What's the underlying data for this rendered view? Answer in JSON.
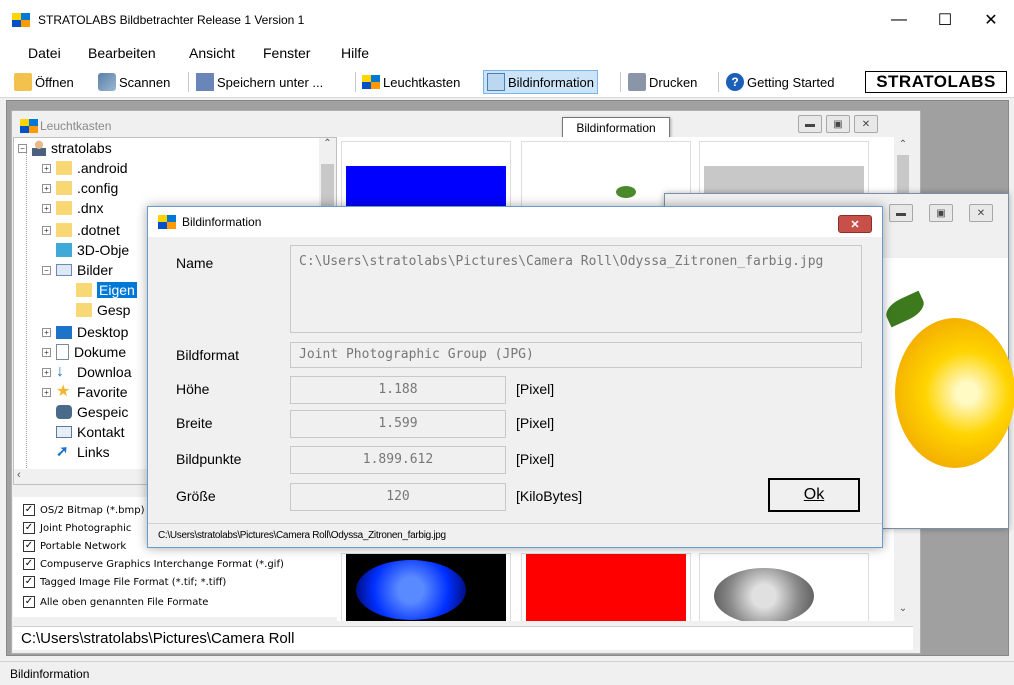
{
  "window": {
    "title": "STRATOLABS Bildbetrachter Release 1 Version 1"
  },
  "menu": [
    "Datei",
    "Bearbeiten",
    "Ansicht",
    "Fenster",
    "Hilfe"
  ],
  "toolbar": {
    "open": "Öffnen",
    "scan": "Scannen",
    "save_as": "Speichern unter ...",
    "lightbox": "Leuchtkasten",
    "image_info": "Bildinformation",
    "print": "Drucken",
    "getting_started": "Getting Started",
    "brand": "STRATOLABS"
  },
  "tooltip": "Bildinformation",
  "lightbox": {
    "title": "Leuchtkasten",
    "tree": {
      "root": "stratolabs",
      "items": [
        ".android",
        ".config",
        ".dnx",
        ".dotnet",
        "3D-Obje",
        "Bilder",
        "Eigen",
        "Gesp",
        "Desktop",
        "Dokume",
        "Downloa",
        "Favorite",
        "Gespeic",
        "Kontakt",
        "Links"
      ]
    },
    "formats": [
      "OS/2 Bitmap (*.bmp)",
      "Joint Photographic",
      "Portable Network",
      "Compuserve Graphics Interchange Format (*.gif)",
      "Tagged Image File Format (*.tif; *.tiff)",
      "Alle oben genannten File Formate"
    ],
    "path": "C:\\Users\\stratolabs\\Pictures\\Camera Roll"
  },
  "dialog": {
    "title": "Bildinformation",
    "name_label": "Name",
    "name_value": "C:\\Users\\stratolabs\\Pictures\\Camera Roll\\Odyssa_Zitronen_farbig.jpg",
    "format_label": "Bildformat",
    "format_value": "Joint Photographic Group (JPG)",
    "height_label": "Höhe",
    "height_value": "1.188",
    "width_label": "Breite",
    "width_value": "1.599",
    "pixels_label": "Bildpunkte",
    "pixels_value": "1.899.612",
    "size_label": "Größe",
    "size_value": "120",
    "unit_pixel": "[Pixel]",
    "unit_kb": "[KiloBytes]",
    "ok": "Ok",
    "status": "C:\\Users\\stratolabs\\Pictures\\Camera Roll\\Odyssa_Zitronen_farbig.jpg"
  },
  "statusbar": "Bildinformation",
  "colors": {
    "accent": "#0078d7",
    "selection": "#cce4f7",
    "folder": "#f8d775"
  }
}
